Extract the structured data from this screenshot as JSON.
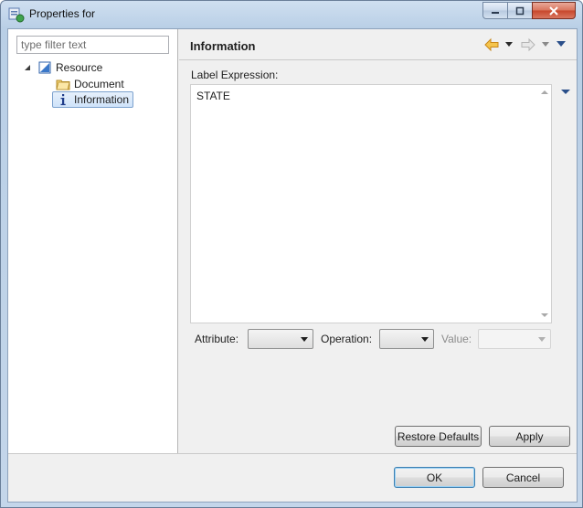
{
  "window": {
    "title": "Properties for"
  },
  "left": {
    "filter": {
      "placeholder": "type filter text",
      "value": ""
    },
    "tree": [
      {
        "label": "Resource",
        "icon": "resource-icon",
        "expanded": true
      },
      {
        "label": "Document",
        "icon": "folder-icon"
      },
      {
        "label": "Information",
        "icon": "info-icon",
        "selected": true
      }
    ]
  },
  "right": {
    "page_title": "Information",
    "label_expression_label": "Label Expression:",
    "expression_text": "STATE",
    "attribute_label": "Attribute:",
    "operation_label": "Operation:",
    "value_label": "Value:",
    "attribute_value": "",
    "operation_value": "",
    "value_value": "",
    "restore_defaults": "Restore Defaults",
    "apply": "Apply"
  },
  "footer": {
    "ok": "OK",
    "cancel": "Cancel"
  },
  "colors": {
    "selection": "#cfe3fa",
    "nav_arrow": "#e8a521",
    "menu_arrow": "#2a4f8a"
  }
}
